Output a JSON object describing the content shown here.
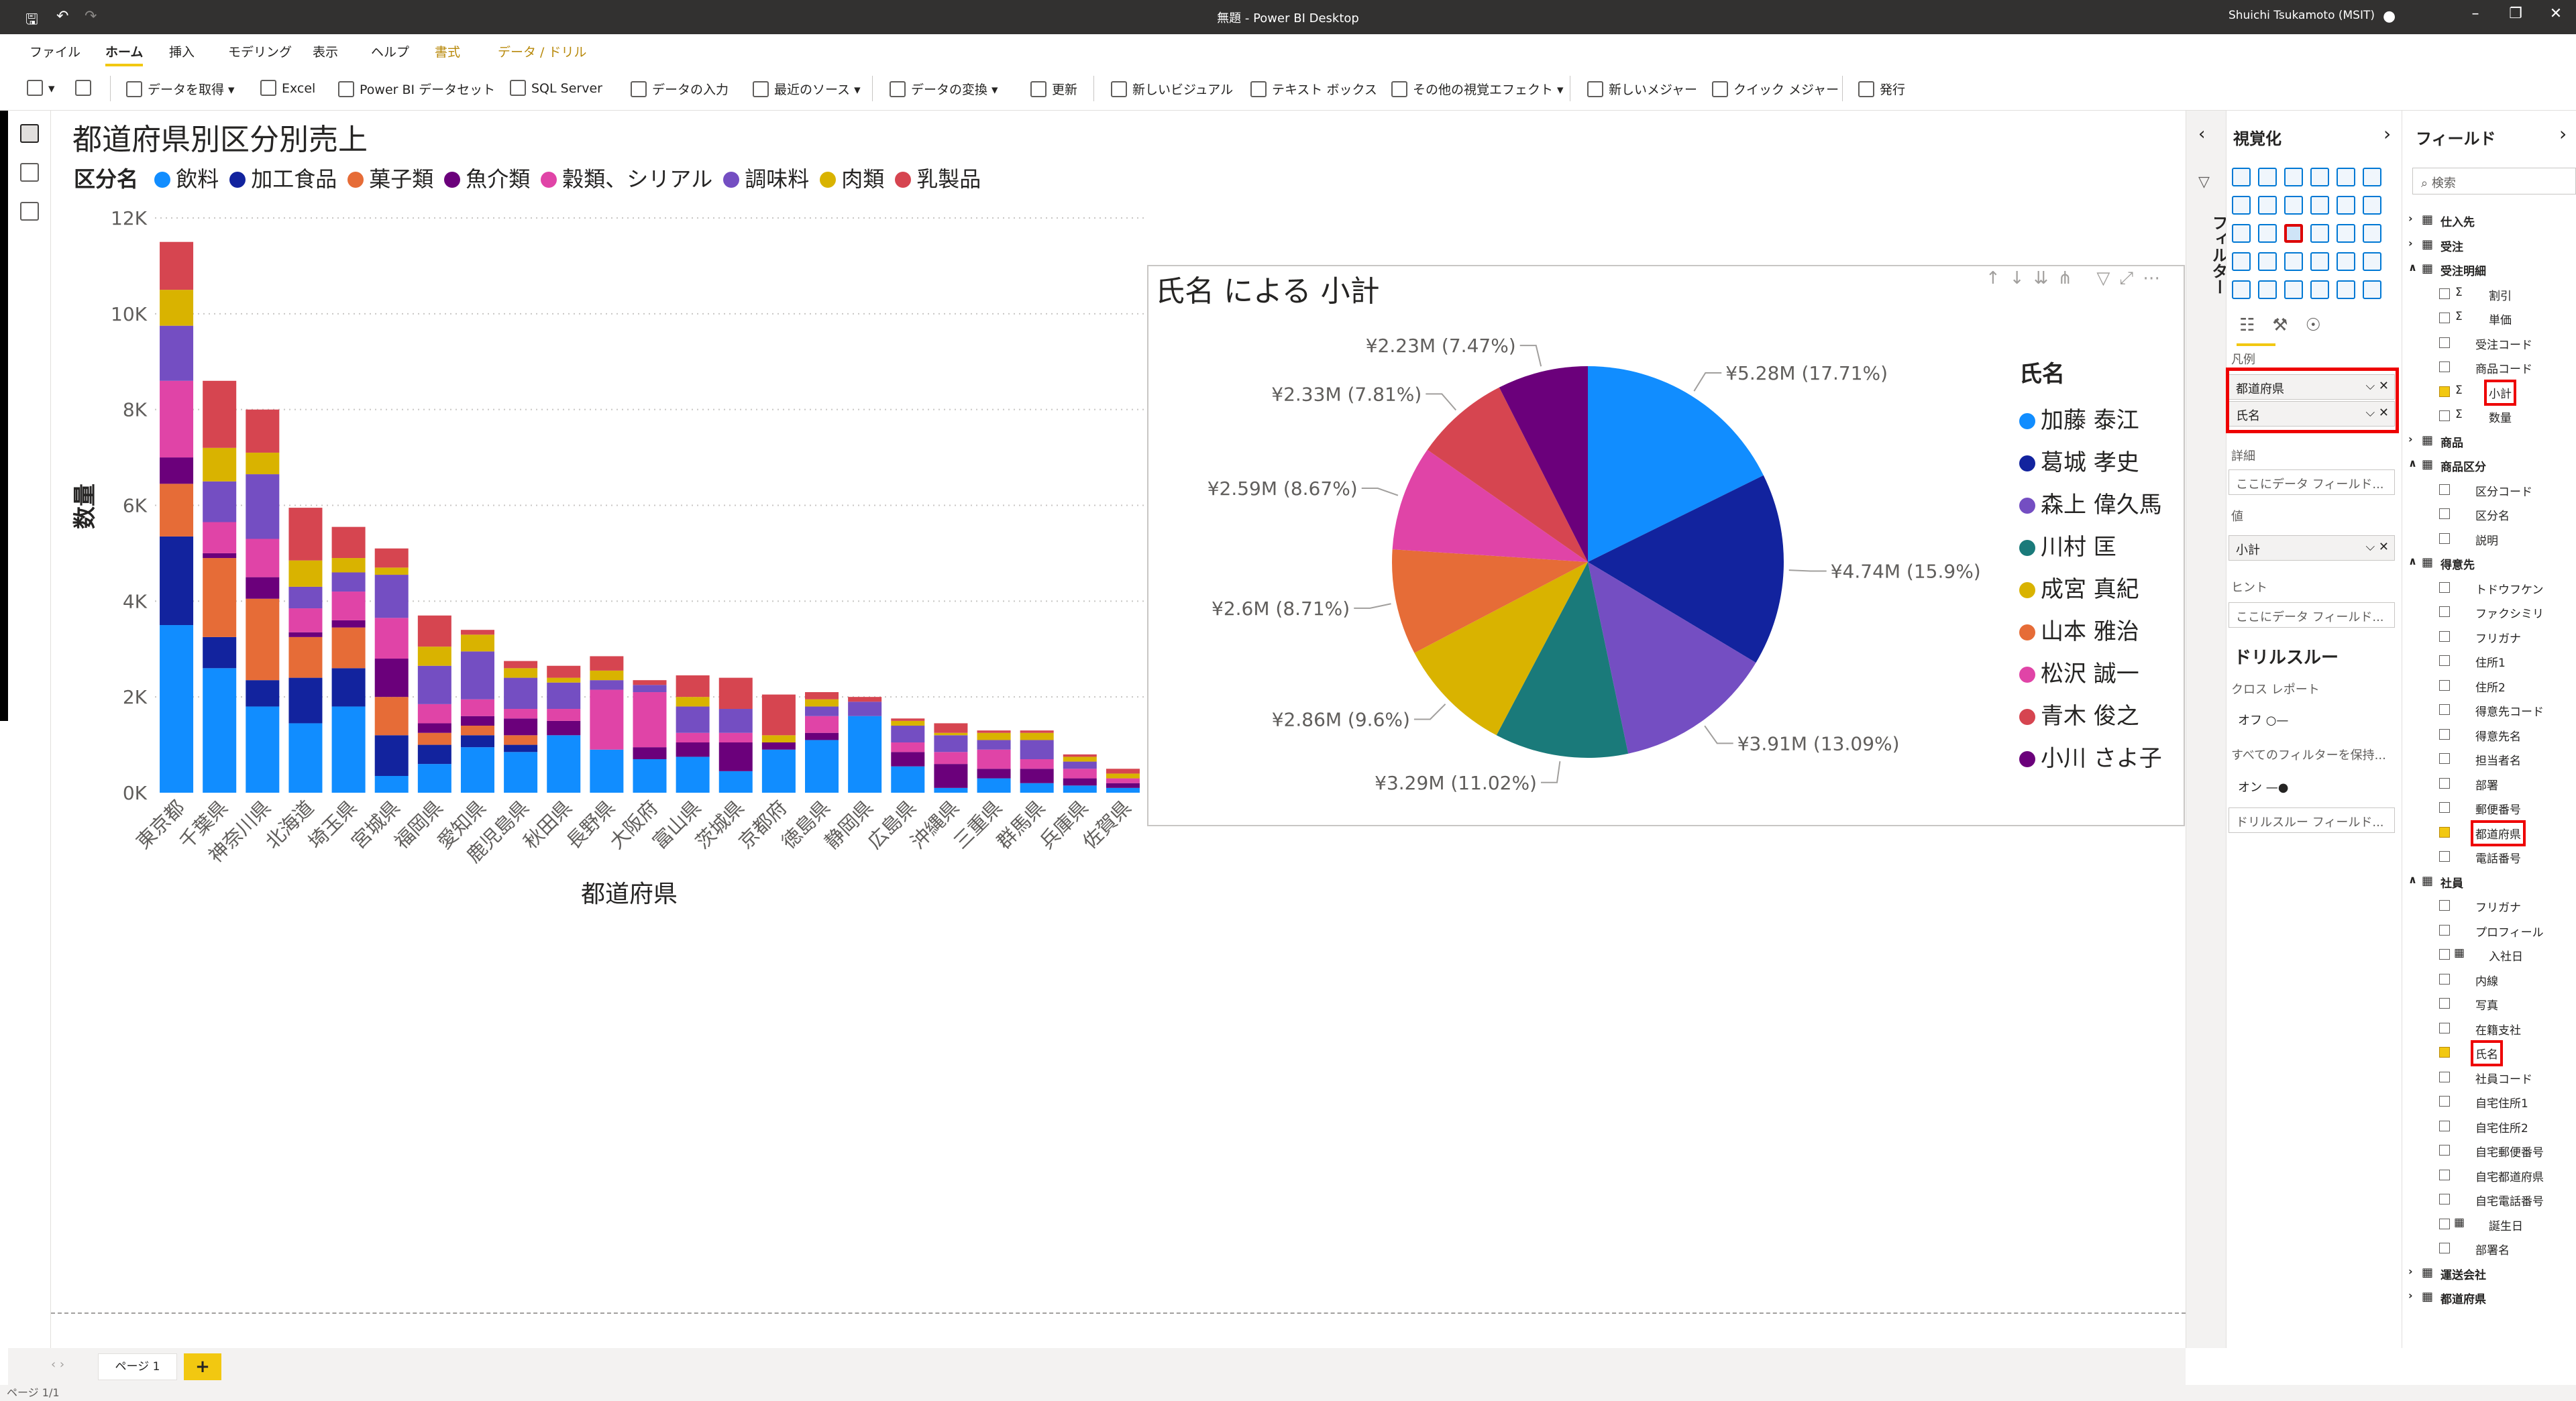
{
  "window": {
    "title": "無題 - Power BI Desktop",
    "user": "Shuichi Tsukamoto (MSIT)"
  },
  "tabs": [
    {
      "label": "ファイル"
    },
    {
      "label": "ホーム"
    },
    {
      "label": "挿入"
    },
    {
      "label": "モデリング"
    },
    {
      "label": "表示"
    },
    {
      "label": "ヘルプ"
    },
    {
      "label": "書式"
    },
    {
      "label": "データ / ドリル"
    }
  ],
  "ribbon": [
    "データを取得",
    "Excel",
    "Power BI データセット",
    "SQL Server",
    "データの入力",
    "最近のソース",
    "データの変換",
    "更新",
    "新しいビジュアル",
    "テキスト ボックス",
    "その他の視覚エフェクト",
    "新しいメジャー",
    "クイック メジャー",
    "発行"
  ],
  "bar_chart_title": "都道府県別区分別売上",
  "bar_legend_title": "区分名",
  "pie_chart_title": "氏名 による 小計",
  "pie_legend_title": "氏名",
  "page": {
    "tab": "ページ 1",
    "add": "+",
    "status": "ページ 1/1"
  },
  "colors": {
    "accent": "#f2c811",
    "highlight": "#e00000"
  },
  "chart_data": [
    {
      "type": "bar",
      "stacked": true,
      "title": "都道府県別区分別売上",
      "xlabel": "都道府県",
      "ylabel": "数量",
      "ylim": [
        0,
        12000
      ],
      "yticks": [
        "0K",
        "2K",
        "4K",
        "6K",
        "8K",
        "10K",
        "12K"
      ],
      "grid": true,
      "legend_position": "top-left",
      "categories": [
        "東京都",
        "千葉県",
        "神奈川県",
        "北海道",
        "埼玉県",
        "宮城県",
        "福岡県",
        "愛知県",
        "鹿児島県",
        "秋田県",
        "長野県",
        "大阪府",
        "富山県",
        "茨城県",
        "京都府",
        "徳島県",
        "静岡県",
        "広島県",
        "沖縄県",
        "三重県",
        "群馬県",
        "兵庫県",
        "佐賀県"
      ],
      "series": [
        {
          "name": "飲料",
          "color": "#118dff",
          "values": [
            3500,
            2600,
            1800,
            1450,
            1800,
            350,
            600,
            950,
            850,
            1200,
            900,
            700,
            750,
            450,
            900,
            1100,
            1600,
            550,
            100,
            300,
            200,
            150,
            100
          ]
        },
        {
          "name": "加工食品",
          "color": "#12239e",
          "values": [
            1850,
            650,
            550,
            950,
            800,
            850,
            400,
            250,
            150,
            0,
            0,
            0,
            0,
            0,
            0,
            0,
            0,
            0,
            0,
            0,
            0,
            0,
            0
          ]
        },
        {
          "name": "菓子類",
          "color": "#e66c37",
          "values": [
            1100,
            1650,
            1700,
            850,
            850,
            800,
            250,
            200,
            200,
            0,
            0,
            0,
            0,
            0,
            0,
            0,
            0,
            0,
            0,
            0,
            0,
            0,
            0
          ]
        },
        {
          "name": "魚介類",
          "color": "#6b007b",
          "values": [
            550,
            100,
            450,
            100,
            150,
            800,
            200,
            200,
            350,
            300,
            0,
            250,
            300,
            600,
            150,
            150,
            0,
            300,
            500,
            200,
            300,
            150,
            100
          ]
        },
        {
          "name": "穀類、シリアル",
          "color": "#e044a7",
          "values": [
            1600,
            650,
            800,
            500,
            600,
            850,
            400,
            350,
            200,
            250,
            1250,
            1150,
            200,
            200,
            0,
            350,
            0,
            200,
            250,
            400,
            200,
            200,
            100
          ]
        },
        {
          "name": "調味料",
          "color": "#744ec2",
          "values": [
            1150,
            850,
            1350,
            450,
            400,
            900,
            800,
            1000,
            650,
            550,
            200,
            150,
            550,
            500,
            0,
            200,
            300,
            350,
            350,
            200,
            400,
            150,
            0
          ]
        },
        {
          "name": "肉類",
          "color": "#d9b300",
          "values": [
            750,
            700,
            450,
            550,
            300,
            150,
            400,
            350,
            200,
            100,
            200,
            0,
            200,
            0,
            150,
            150,
            0,
            100,
            50,
            150,
            150,
            100,
            100
          ]
        },
        {
          "name": "乳製品",
          "color": "#d64550",
          "values": [
            1000,
            1400,
            900,
            1100,
            650,
            400,
            650,
            100,
            150,
            250,
            300,
            100,
            450,
            650,
            850,
            150,
            100,
            50,
            200,
            50,
            50,
            50,
            100
          ]
        }
      ]
    },
    {
      "type": "pie",
      "title": "氏名 による 小計",
      "legend_title": "氏名",
      "legend_position": "right",
      "slices": [
        {
          "name": "加藤 泰江",
          "value": 5.28,
          "percent": 17.71,
          "label": "¥5.28M (17.71%)",
          "color": "#118dff"
        },
        {
          "name": "葛城 孝史",
          "value": 4.74,
          "percent": 15.9,
          "label": "¥4.74M (15.9%)",
          "color": "#12239e"
        },
        {
          "name": "森上 偉久馬",
          "value": 3.91,
          "percent": 13.09,
          "label": "¥3.91M (13.09%)",
          "color": "#744ec2"
        },
        {
          "name": "川村 匡",
          "value": 3.29,
          "percent": 11.02,
          "label": "¥3.29M (11.02%)",
          "color": "#1a7a7a"
        },
        {
          "name": "成宮 真紀",
          "value": 2.86,
          "percent": 9.6,
          "label": "¥2.86M (9.6%)",
          "color": "#d9b300"
        },
        {
          "name": "山本 雅治",
          "value": 2.6,
          "percent": 8.71,
          "label": "¥2.6M (8.71%)",
          "color": "#e66c37"
        },
        {
          "name": "松沢 誠一",
          "value": 2.59,
          "percent": 8.67,
          "label": "¥2.59M (8.67%)",
          "color": "#e044a7"
        },
        {
          "name": "青木 俊之",
          "value": 2.33,
          "percent": 7.81,
          "label": "¥2.33M (7.81%)",
          "color": "#d64550"
        },
        {
          "name": "小川 さよ子",
          "value": 2.23,
          "percent": 7.47,
          "label": "¥2.23M (7.47%)",
          "color": "#6b007b"
        }
      ]
    }
  ],
  "filters_label": "フィルター",
  "viz_pane": {
    "title": "視覚化",
    "legend_well_label": "凡例",
    "legend_fields": [
      "都道府県",
      "氏名"
    ],
    "details_label": "詳細",
    "details_placeholder": "ここにデータ フィールド...",
    "values_label": "値",
    "values_field": "小計",
    "tooltips_label": "ヒント",
    "tooltips_placeholder": "ここにデータ フィールド...",
    "drill_title": "ドリルスルー",
    "cross_report": "クロス レポート",
    "off": "オフ",
    "keep_filters": "すべてのフィルターを保持...",
    "on": "オン",
    "drill_placeholder": "ドリルスルー フィールド..."
  },
  "fields_pane": {
    "title": "フィールド",
    "search_placeholder": "検索",
    "items": [
      {
        "label": "仕入先",
        "level": 0,
        "table": true
      },
      {
        "label": "受注",
        "level": 0,
        "table": true
      },
      {
        "label": "受注明細",
        "level": 0,
        "table": true,
        "open": true
      },
      {
        "label": "割引",
        "level": 1,
        "sigma": true
      },
      {
        "label": "単価",
        "level": 1,
        "sigma": true
      },
      {
        "label": "受注コード",
        "level": 1
      },
      {
        "label": "商品コード",
        "level": 1
      },
      {
        "label": "小計",
        "level": 1,
        "sigma": true,
        "checked": true,
        "highlight": true
      },
      {
        "label": "数量",
        "level": 1,
        "sigma": true
      },
      {
        "label": "商品",
        "level": 0,
        "table": true
      },
      {
        "label": "商品区分",
        "level": 0,
        "table": true,
        "open": true
      },
      {
        "label": "区分コード",
        "level": 1
      },
      {
        "label": "区分名",
        "level": 1
      },
      {
        "label": "説明",
        "level": 1
      },
      {
        "label": "得意先",
        "level": 0,
        "table": true,
        "open": true
      },
      {
        "label": "トドウフケン",
        "level": 1
      },
      {
        "label": "ファクシミリ",
        "level": 1
      },
      {
        "label": "フリガナ",
        "level": 1
      },
      {
        "label": "住所1",
        "level": 1
      },
      {
        "label": "住所2",
        "level": 1
      },
      {
        "label": "得意先コード",
        "level": 1
      },
      {
        "label": "得意先名",
        "level": 1
      },
      {
        "label": "担当者名",
        "level": 1
      },
      {
        "label": "部署",
        "level": 1
      },
      {
        "label": "郵便番号",
        "level": 1
      },
      {
        "label": "都道府県",
        "level": 1,
        "checked": true,
        "highlight": true
      },
      {
        "label": "電話番号",
        "level": 1
      },
      {
        "label": "社員",
        "level": 0,
        "table": true,
        "open": true
      },
      {
        "label": "フリガナ",
        "level": 1
      },
      {
        "label": "プロフィール",
        "level": 1
      },
      {
        "label": "入社日",
        "level": 1,
        "table": true
      },
      {
        "label": "内線",
        "level": 1
      },
      {
        "label": "写真",
        "level": 1
      },
      {
        "label": "在籍支社",
        "level": 1
      },
      {
        "label": "氏名",
        "level": 1,
        "checked": true,
        "highlight": true
      },
      {
        "label": "社員コード",
        "level": 1
      },
      {
        "label": "自宅住所1",
        "level": 1
      },
      {
        "label": "自宅住所2",
        "level": 1
      },
      {
        "label": "自宅郵便番号",
        "level": 1
      },
      {
        "label": "自宅都道府県",
        "level": 1
      },
      {
        "label": "自宅電話番号",
        "level": 1
      },
      {
        "label": "誕生日",
        "level": 1,
        "table": true
      },
      {
        "label": "部署名",
        "level": 1
      },
      {
        "label": "運送会社",
        "level": 0,
        "table": true
      },
      {
        "label": "都道府県",
        "level": 0,
        "table": true
      }
    ]
  }
}
